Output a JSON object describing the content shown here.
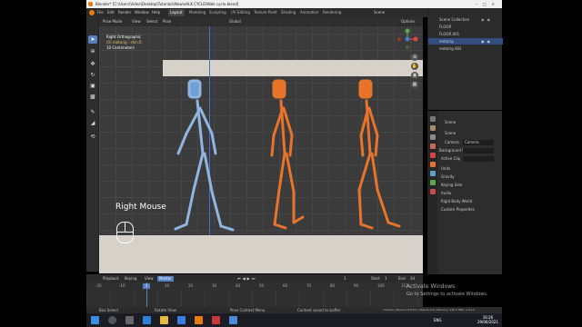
{
  "window": {
    "title": "Blender* [C:\\Users\\Video\\Desktop\\Tutorials\\New\\eALK CYCLE\\Walk cycle.blend]"
  },
  "menu": {
    "items": [
      "File",
      "Edit",
      "Render",
      "Window",
      "Help"
    ],
    "workspaces": [
      "Layout",
      "Modeling",
      "Sculpting",
      "UV Editing",
      "Texture Paint",
      "Shading",
      "Animation",
      "Rendering"
    ],
    "active_workspace": "Layout",
    "scene": "Scene",
    "view_layer": "View Layer"
  },
  "viewport": {
    "mode": "Pose Mode",
    "header_items": [
      "View",
      "Select",
      "Pose"
    ],
    "pivot": "Global",
    "overlay_title": "Right Orthographic",
    "overlay_subtitle": "(0) metarig : shin.R",
    "overlay_units": "10 Centimeters",
    "right_mouse_label": "Right Mouse",
    "options_label": "Options"
  },
  "outliner": {
    "rows": [
      {
        "label": "Scene Collection",
        "selected": false
      },
      {
        "label": "FLOOR",
        "selected": false
      },
      {
        "label": "FLOOR.001",
        "selected": false
      },
      {
        "label": "metarig",
        "selected": true
      },
      {
        "label": "metarig.002",
        "selected": false
      }
    ]
  },
  "properties": {
    "section": "Scene",
    "subsection": "Scene",
    "camera_label": "Camera",
    "camera_value": "Camera",
    "background_label": "Background S...",
    "active_clip_label": "Active Clip",
    "panels": [
      "Units",
      "Gravity",
      "Keying Sets",
      "Audio",
      "Rigid Body World",
      "Custom Properties"
    ]
  },
  "timeline": {
    "header": [
      "Playback",
      "Keying",
      "View",
      "Marker"
    ],
    "start_label": "Start",
    "start_value": "1",
    "end_label": "End",
    "end_value": "34",
    "current_frame": "1",
    "ticks": [
      "-20",
      "-10",
      "0",
      "10",
      "20",
      "30",
      "40",
      "50",
      "60",
      "70",
      "80",
      "90",
      "100",
      "110"
    ]
  },
  "windows_watermark": {
    "title": "Activate Windows",
    "subtitle": "Go to Settings to activate Windows."
  },
  "statusbar": {
    "items": [
      "Box Select",
      "Rotate View",
      "Pose Context Menu",
      "Context saved to buffer"
    ],
    "stats": "metarig | Bones:1/5/170 | Objects:1/4 | Memory: 130.2 MiB | 2.91.2"
  },
  "taskbar": {
    "time": "16:26",
    "date": "29/06/2021",
    "lang": "ENG"
  },
  "colors": {
    "blender_blue": "#5680c2",
    "rig_blue": "#6ea0d6",
    "rig_orange": "#e8742c",
    "selection_blue": "#334d80"
  }
}
